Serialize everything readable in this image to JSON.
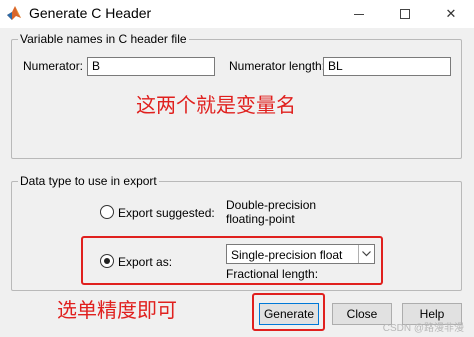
{
  "window": {
    "title": "Generate C Header",
    "minimize_symbol": "—",
    "close_symbol": "✕"
  },
  "group_variables": {
    "legend": "Variable names in C header file",
    "numerator_label": "Numerator:",
    "numerator_value": "B",
    "numerator_length_label": "Numerator length:",
    "numerator_length_value": "BL",
    "annotation": "这两个就是变量名"
  },
  "group_datatype": {
    "legend": "Data type to use in export",
    "export_suggested_label": "Export suggested:",
    "suggested_type_line1": "Double-precision",
    "suggested_type_line2": "floating-point",
    "export_as_label": "Export as:",
    "export_as_selected": "Single-precision float",
    "fractional_length_label": "Fractional length:",
    "export_suggested_checked": false,
    "export_as_checked": true
  },
  "annotation_bottom": "选单精度即可",
  "buttons": {
    "generate": "Generate",
    "close": "Close",
    "help": "Help"
  },
  "watermark": "CSDN @路漫非漫",
  "colors": {
    "annotation_red": "#e0201e",
    "background": "#f0f0f0",
    "default_button_border": "#0078d7"
  }
}
